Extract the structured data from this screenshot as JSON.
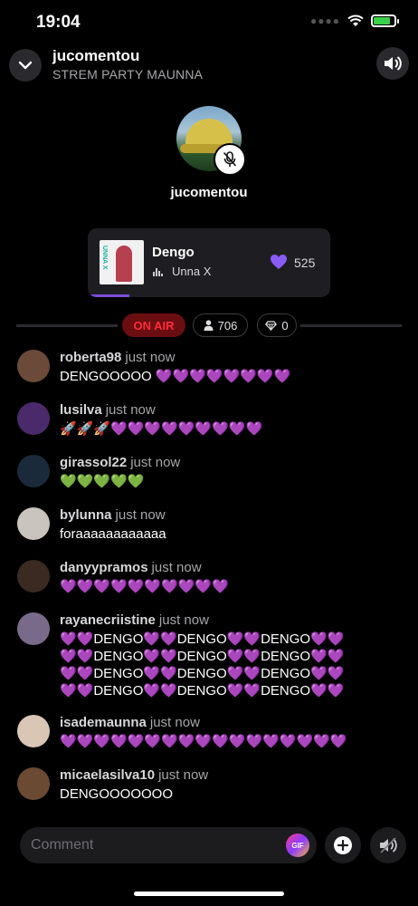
{
  "status_bar": {
    "time": "19:04"
  },
  "header": {
    "title": "jucomentou",
    "subtitle": "STREM PARTY MAUNNA"
  },
  "host": {
    "name": "jucomentou"
  },
  "music": {
    "title": "Dengo",
    "artist": "Unna X",
    "likes": "525",
    "album_text": "UNNA X",
    "progress_fraction": 0.17
  },
  "room": {
    "status": "ON AIR",
    "listeners": "706",
    "gems": "0"
  },
  "chat": [
    {
      "user": "roberta98",
      "time": "just now",
      "text": "DENGOOOOO 💜💜💜💜💜💜💜💜",
      "avatar_color": "#6b4a3a"
    },
    {
      "user": "lusilva",
      "time": "just now",
      "text": "🚀🚀🚀💜💜💜💜💜💜💜💜💜",
      "avatar_color": "#4a2a6a"
    },
    {
      "user": "girassol22",
      "time": "just now",
      "text": "💚💚💚💚💚",
      "avatar_color": "#1a2a3a"
    },
    {
      "user": "bylunna",
      "time": "just now",
      "text": "foraaaaaaaaaaaa",
      "avatar_color": "#c9c4bd"
    },
    {
      "user": "danyypramos",
      "time": "just now",
      "text": "💜💜💜💜💜💜💜💜💜💜",
      "avatar_color": "#3a2a22"
    },
    {
      "user": "rayanecriistine",
      "time": "just now",
      "text": "💜💜DENGO💜💜DENGO💜💜DENGO💜💜\n💜💜DENGO💜💜DENGO💜💜DENGO💜💜\n💜💜DENGO💜💜DENGO💜💜DENGO💜💜\n💜💜DENGO💜💜DENGO💜💜DENGO💜💜",
      "avatar_color": "#7a6a8a"
    },
    {
      "user": "isademaunna",
      "time": "just now",
      "text": "💜💜💜💜💜💜💜💜💜💜💜💜💜💜💜💜💜",
      "avatar_color": "#d9c6b4"
    },
    {
      "user": "micaelasilva10",
      "time": "just now",
      "text": "DENGOOOOOOO",
      "avatar_color": "#6a4a32"
    }
  ],
  "composer": {
    "placeholder": "Comment",
    "gif_label": "GIF"
  },
  "icons": {
    "collapse": "chevron-down-icon",
    "sound": "speaker-icon",
    "mic": "mic-muted-icon",
    "like": "heart-icon",
    "listeners": "person-icon",
    "gems": "diamond-icon",
    "add": "plus-icon",
    "speaker_toggle": "speaker-off-icon"
  },
  "colors": {
    "accent": "#7c4bd8",
    "on_air": "#ff2b3a",
    "heart": "#8a5cf6"
  }
}
